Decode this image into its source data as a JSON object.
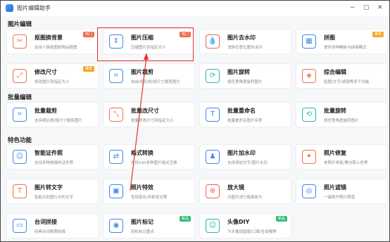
{
  "window": {
    "title": "图片编辑助手"
  },
  "controls": {
    "min": "−",
    "max": "▢",
    "close": "✕"
  },
  "sections": {
    "edit": "图片编辑",
    "batch": "批量编辑",
    "special": "特色功能"
  },
  "cards": [
    {
      "title": "抠图换背景",
      "desc": "支持人像抠图和物品抠图",
      "badge": "热门",
      "badge_color": "#f06b4a",
      "icon": "scissors-icon",
      "icon_color": "#f0704a"
    },
    {
      "title": "图片压缩",
      "desc": "压缩图片至指定大小",
      "badge": "热门",
      "badge_color": "#f06b4a",
      "icon": "compress-icon",
      "icon_color": "#3b86f0"
    },
    {
      "title": "图片去水印",
      "desc": "消除任意位置的水印",
      "badge": "",
      "badge_color": "",
      "icon": "drop-icon",
      "icon_color": "#f0605a"
    },
    {
      "title": "拼图",
      "desc": "提供多种模板与拼接模式",
      "badge": "推荐",
      "badge_color": "#f5a623",
      "icon": "grid-icon",
      "icon_color": "#3b86f0"
    },
    {
      "title": "修改尺寸",
      "desc": "修改图片到指定大小",
      "badge": "推荐",
      "badge_color": "#f5a623",
      "icon": "resize-icon",
      "icon_color": "#f0704a"
    },
    {
      "title": "图片裁剪",
      "desc": "自由/按比例/按尺寸裁剪图片",
      "badge": "",
      "badge_color": "",
      "icon": "crop-icon",
      "icon_color": "#3b86f0"
    },
    {
      "title": "图片旋转",
      "desc": "按任意角度旋转图片",
      "badge": "",
      "badge_color": "",
      "icon": "rotate-icon",
      "icon_color": "#22b7a8"
    },
    {
      "title": "综合编辑",
      "desc": "贴图/文字/滤镜等多个功能",
      "badge": "",
      "badge_color": "",
      "icon": "shapes-icon",
      "icon_color": "#f0704a"
    },
    {
      "title": "批量裁剪",
      "desc": "支持按比例/按尺寸裁剪图片",
      "badge": "",
      "badge_color": "",
      "icon": "batch-crop-icon",
      "icon_color": "#3b86f0"
    },
    {
      "title": "批量改尺寸",
      "desc": "批量修改尺寸到指定大小",
      "badge": "",
      "badge_color": "",
      "icon": "batch-resize-icon",
      "icon_color": "#f0704a"
    },
    {
      "title": "批量重命名",
      "desc": "批量重命名图片名称",
      "badge": "",
      "badge_color": "",
      "icon": "rename-icon",
      "icon_color": "#3b86f0"
    },
    {
      "title": "批量旋转",
      "desc": "按任意角度旋转图片",
      "badge": "",
      "badge_color": "",
      "icon": "batch-rotate-icon",
      "icon_color": "#22b7a8"
    },
    {
      "title": "智能证件照",
      "desc": "支持多种规格的证件照",
      "badge": "",
      "badge_color": "",
      "icon": "id-photo-icon",
      "icon_color": "#3b86f0"
    },
    {
      "title": "格式转换",
      "desc": "支持100多种图片格式互换",
      "badge": "",
      "badge_color": "",
      "icon": "convert-icon",
      "icon_color": "#3b86f0"
    },
    {
      "title": "图片加水印",
      "desc": "支持添加文字/图片水印",
      "badge": "",
      "badge_color": "",
      "icon": "stamp-icon",
      "icon_color": "#3b86f0"
    },
    {
      "title": "照片修复",
      "desc": "老照片修复/黑白照上色等",
      "badge": "",
      "badge_color": "",
      "icon": "wand-icon",
      "icon_color": "#f0704a"
    },
    {
      "title": "图片转文字",
      "desc": "智能识别图片中的文字",
      "badge": "",
      "badge_color": "",
      "icon": "text-icon",
      "icon_color": "#f0704a"
    },
    {
      "title": "照片特效",
      "desc": "性别变化/年龄变化等",
      "badge": "",
      "badge_color": "",
      "icon": "image-effect-icon",
      "icon_color": "#3b86f0"
    },
    {
      "title": "放大镜",
      "desc": "对图片进行局部放大",
      "badge": "",
      "badge_color": "",
      "icon": "magnifier-icon",
      "icon_color": "#f0605a"
    },
    {
      "title": "照片滤镜",
      "desc": "一键提升照片质感",
      "badge": "",
      "badge_color": "",
      "icon": "filter-icon",
      "icon_color": "#3b86f0"
    },
    {
      "title": "台词拼接",
      "desc": "经典台词剧照拼接",
      "badge": "",
      "badge_color": "",
      "icon": "subtitle-icon",
      "icon_color": "#3b86f0"
    },
    {
      "title": "图片标记",
      "desc": "轻松标记重点",
      "badge": "新品",
      "badge_color": "#2fbf71",
      "icon": "marker-icon",
      "icon_color": "#3b86f0"
    },
    {
      "title": "头像DIY",
      "desc": "为头像加国旗/口罩/圣诞帽等",
      "badge": "新品",
      "badge_color": "#2fbf71",
      "icon": "avatar-icon",
      "icon_color": "#22b7a8"
    },
    {
      "title": "",
      "desc": "",
      "badge": "",
      "badge_color": "",
      "icon": "",
      "icon_color": ""
    }
  ]
}
